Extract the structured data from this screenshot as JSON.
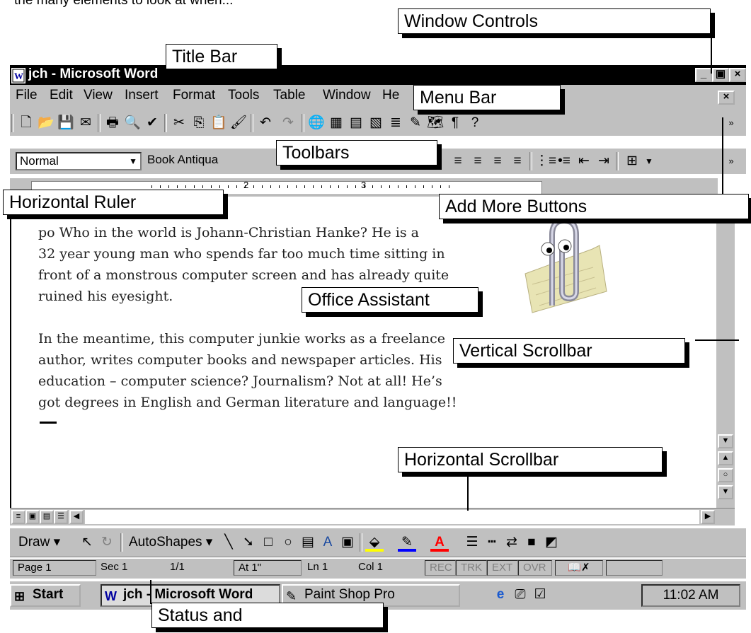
{
  "window": {
    "title": "jch - Microsoft Word",
    "controls": [
      "_",
      "▣",
      "×"
    ]
  },
  "menu": {
    "items": [
      "File",
      "Edit",
      "View",
      "Insert",
      "Format",
      "Tools",
      "Table",
      "Window",
      "He"
    ],
    "close_doc": "×"
  },
  "formatting": {
    "style": "Normal",
    "font": "Book Antiqua"
  },
  "ruler": {
    "numbers": [
      "2",
      "3"
    ]
  },
  "document": {
    "paragraph1": [
      "po Who in the world is Johann-Christian Hanke?  He is a",
      "32 year young man who spends far too much time sitting in",
      "front of a monstrous computer screen and has already quite",
      "ruined his eyesight."
    ],
    "paragraph2": [
      "In the meantime, this computer junkie works as a freelance",
      "author, writes computer books and newspaper articles. His",
      "education – computer science?  Journalism?  Not at all!  He’s",
      "got degrees in English and German literature and language!!"
    ]
  },
  "drawing": {
    "draw_label": "Draw ▾",
    "autoshapes_label": "AutoShapes ▾"
  },
  "status": {
    "page": "Page 1",
    "sec": "Sec 1",
    "pages": "1/1",
    "at": "At 1\"",
    "ln": "Ln 1",
    "col": "Col 1",
    "rec": "REC",
    "trk": "TRK",
    "ext": "EXT",
    "ovr": "OVR"
  },
  "taskbar": {
    "start": "Start",
    "word_task": "jch - Microsoft Word",
    "paint_task": "Paint Shop Pro",
    "clock": "11:02 AM"
  },
  "callouts": {
    "window_controls": "Window Controls",
    "title_bar": "Title Bar",
    "menu_bar": "Menu Bar",
    "toolbars": "Toolbars",
    "horizontal_ruler": "Horizontal Ruler",
    "add_more_buttons": "Add More Buttons",
    "office_assistant": "Office Assistant",
    "vertical_scrollbar": "Vertical Scrollbar",
    "horizontal_scrollbar": "Horizontal Scrollbar",
    "status_and": "Status and"
  },
  "colors": {
    "title_bar": "#000000",
    "chrome": "#c0c0c0",
    "spell_error": "#d00000"
  }
}
